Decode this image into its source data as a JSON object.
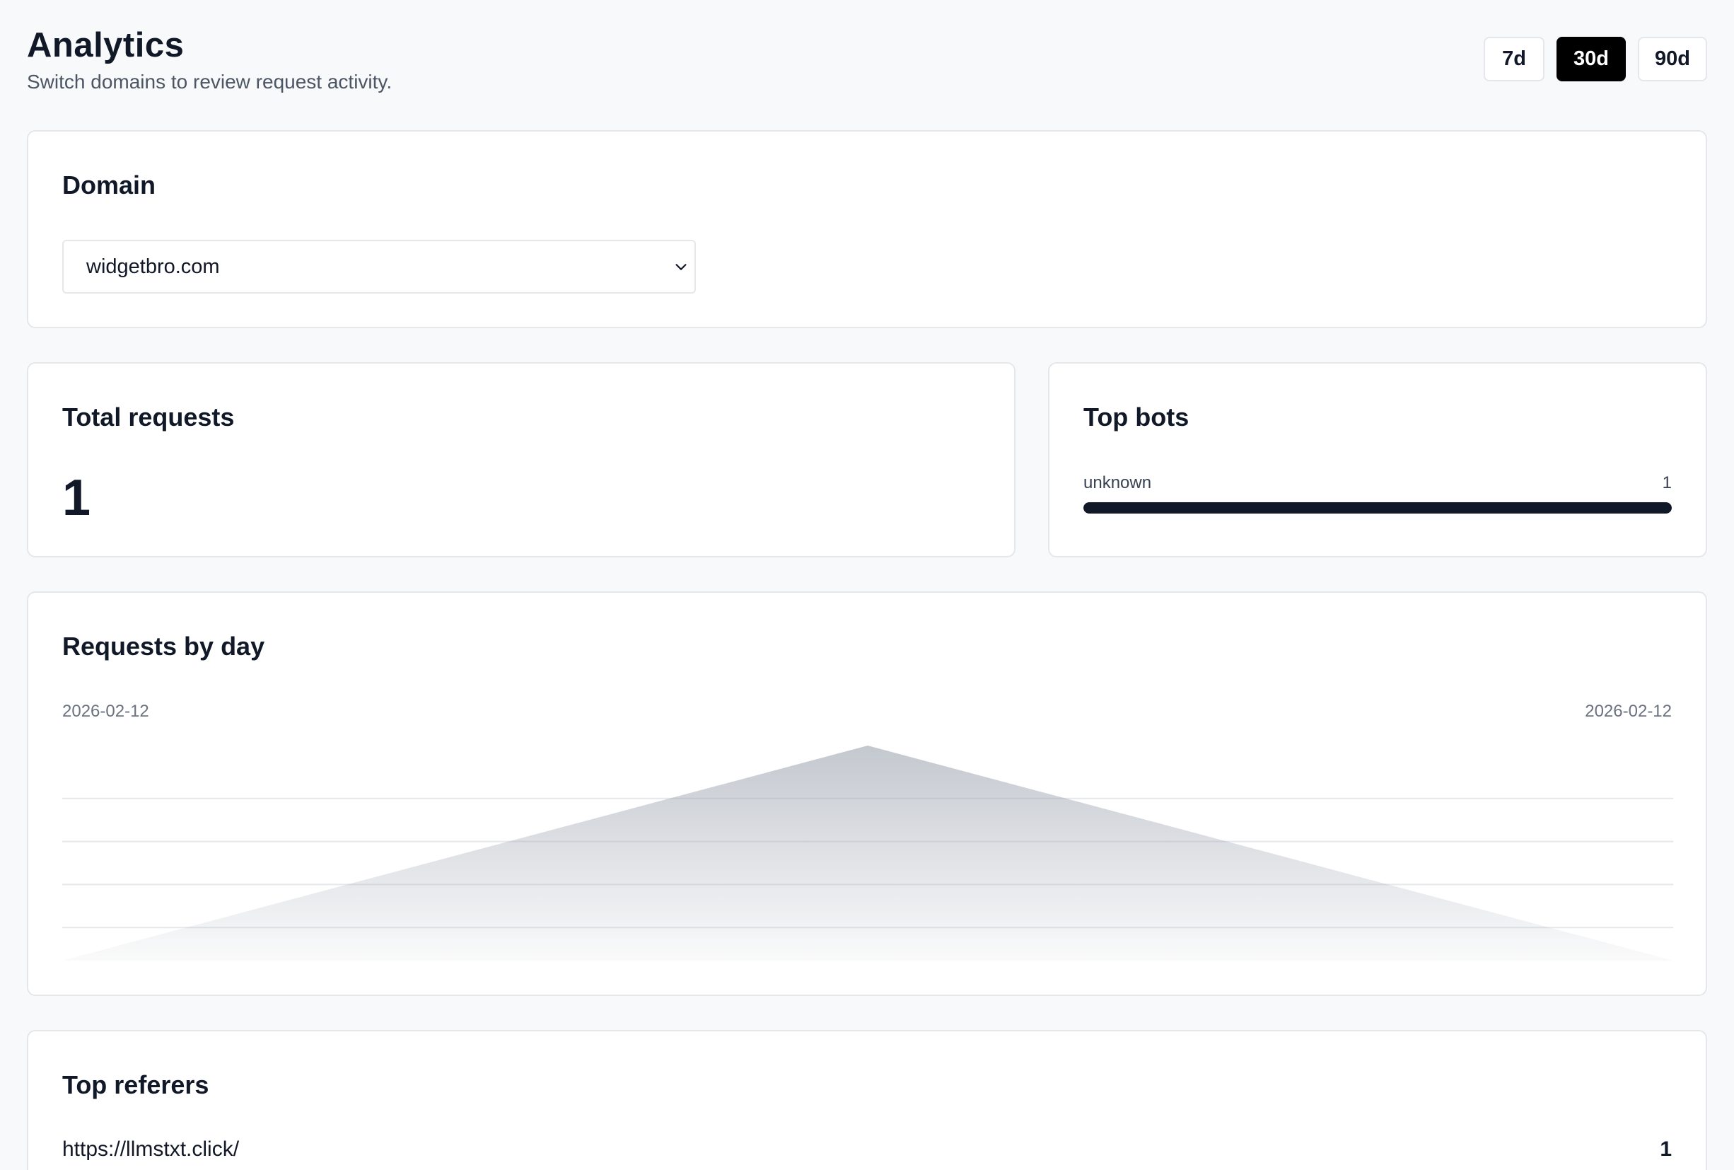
{
  "header": {
    "title": "Analytics",
    "subtitle": "Switch domains to review request activity."
  },
  "range": {
    "options": [
      "7d",
      "30d",
      "90d"
    ],
    "selected": "30d"
  },
  "domain": {
    "title": "Domain",
    "selected": "widgetbro.com",
    "icon": "chevron-down-icon"
  },
  "totals": {
    "title": "Total requests",
    "value": "1"
  },
  "bots": {
    "title": "Top bots",
    "items": [
      {
        "name": "unknown",
        "count": "1",
        "share": 1.0
      }
    ],
    "bar_color": "#111827"
  },
  "chart": {
    "title": "Requests by day",
    "start_label": "2026-02-12",
    "end_label": "2026-02-12"
  },
  "chart_data": {
    "type": "area",
    "title": "Requests by day",
    "x": [
      "2026-02-12"
    ],
    "values": [
      1
    ],
    "ylim": [
      0,
      1
    ],
    "grid": true,
    "fill_color": "#9ca3af"
  },
  "referers": {
    "title": "Top referers",
    "items": [
      {
        "url": "https://llmstxt.click/",
        "count": "1"
      }
    ]
  }
}
